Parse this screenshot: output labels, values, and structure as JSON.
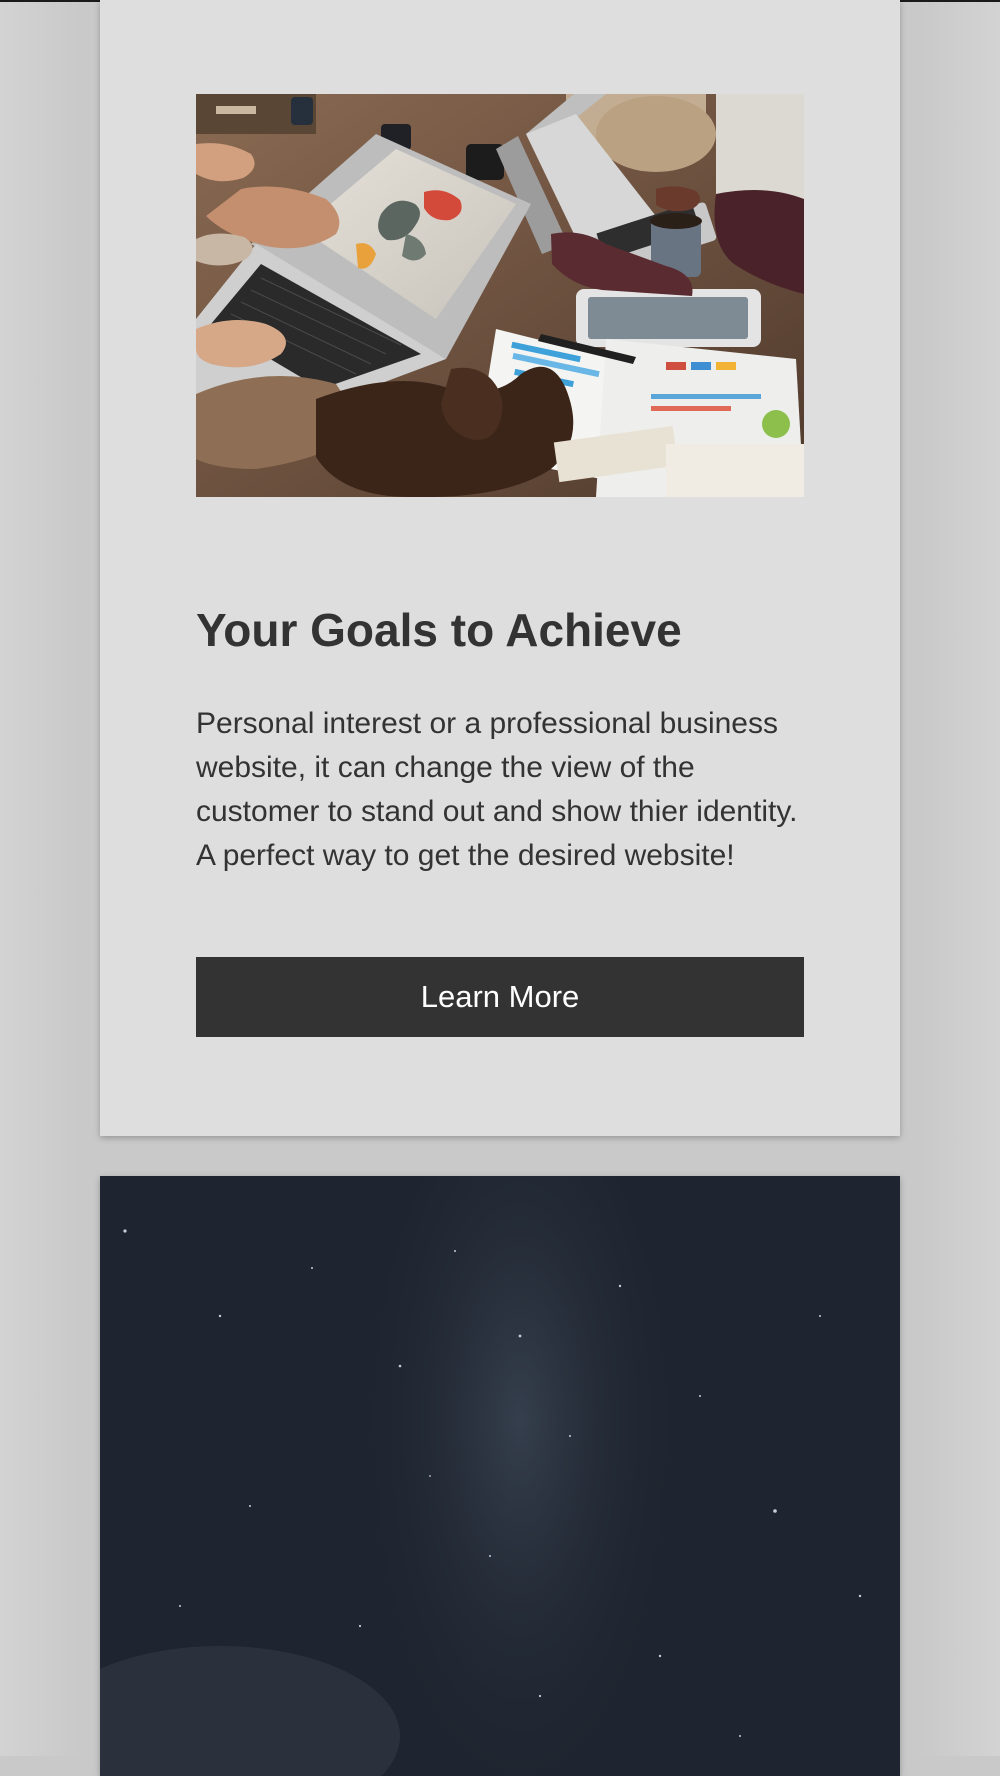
{
  "card": {
    "title": "Your Goals to Achieve",
    "body": "Personal interest or a professional business website, it can change the view of the customer to stand out and show thier identity. A perfect way to get the desired website!",
    "button_label": "Learn More"
  },
  "colors": {
    "page_background": "#c9c9c9",
    "card_background": "#dedede",
    "text": "#333333",
    "button_background": "#333333",
    "button_text": "#ffffff",
    "night_sky": "#1f2530"
  },
  "images": {
    "card_photo": "team-meeting-photo",
    "second_card": "night-sky-photo"
  }
}
